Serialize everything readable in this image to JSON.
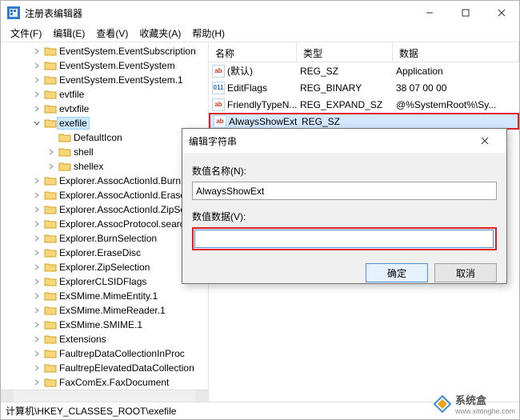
{
  "window": {
    "title": "注册表编辑器"
  },
  "menu": {
    "file": "文件(F)",
    "edit": "编辑(E)",
    "view": "查看(V)",
    "fav": "收藏夹(A)",
    "help": "帮助(H)"
  },
  "tree": [
    {
      "ind": 2,
      "exp": ">",
      "label": "EventSystem.EventSubscription"
    },
    {
      "ind": 2,
      "exp": ">",
      "label": "EventSystem.EventSystem"
    },
    {
      "ind": 2,
      "exp": ">",
      "label": "EventSystem.EventSystem.1"
    },
    {
      "ind": 2,
      "exp": ">",
      "label": "evtfile"
    },
    {
      "ind": 2,
      "exp": ">",
      "label": "evtxfile"
    },
    {
      "ind": 2,
      "exp": "v",
      "label": "exefile",
      "sel": true
    },
    {
      "ind": 3,
      "exp": "",
      "label": "DefaultIcon"
    },
    {
      "ind": 3,
      "exp": ">",
      "label": "shell"
    },
    {
      "ind": 3,
      "exp": ">",
      "label": "shellex"
    },
    {
      "ind": 2,
      "exp": ">",
      "label": "Explorer.AssocActionId.BurnSelection"
    },
    {
      "ind": 2,
      "exp": ">",
      "label": "Explorer.AssocActionId.EraseDisc"
    },
    {
      "ind": 2,
      "exp": ">",
      "label": "Explorer.AssocActionId.ZipSelection"
    },
    {
      "ind": 2,
      "exp": ">",
      "label": "Explorer.AssocProtocol.search-ms"
    },
    {
      "ind": 2,
      "exp": ">",
      "label": "Explorer.BurnSelection"
    },
    {
      "ind": 2,
      "exp": ">",
      "label": "Explorer.EraseDisc"
    },
    {
      "ind": 2,
      "exp": ">",
      "label": "Explorer.ZipSelection"
    },
    {
      "ind": 2,
      "exp": ">",
      "label": "ExplorerCLSIDFlags"
    },
    {
      "ind": 2,
      "exp": ">",
      "label": "ExSMime.MimeEntity.1"
    },
    {
      "ind": 2,
      "exp": ">",
      "label": "ExSMime.MimeReader.1"
    },
    {
      "ind": 2,
      "exp": ">",
      "label": "ExSMime.SMIME.1"
    },
    {
      "ind": 2,
      "exp": ">",
      "label": "Extensions"
    },
    {
      "ind": 2,
      "exp": ">",
      "label": "FaultrepDataCollectionInProc"
    },
    {
      "ind": 2,
      "exp": ">",
      "label": "FaultrepElevatedDataCollection"
    },
    {
      "ind": 2,
      "exp": ">",
      "label": "FaxComEx.FaxDocument"
    }
  ],
  "cols": {
    "name": "名称",
    "type": "类型",
    "data": "数据"
  },
  "rows": [
    {
      "icon": "str",
      "name": "(默认)",
      "type": "REG_SZ",
      "data": "Application"
    },
    {
      "icon": "bin",
      "name": "EditFlags",
      "type": "REG_BINARY",
      "data": "38 07 00 00"
    },
    {
      "icon": "str",
      "name": "FriendlyTypeN...",
      "type": "REG_EXPAND_SZ",
      "data": "@%SystemRoot%\\Sy..."
    },
    {
      "icon": "str",
      "name": "AlwaysShowExt",
      "type": "REG_SZ",
      "data": "",
      "hl": true,
      "sel": true
    }
  ],
  "dlg": {
    "title": "编辑字符串",
    "name_label": "数值名称(N):",
    "name_value": "AlwaysShowExt",
    "data_label": "数值数据(V):",
    "data_value": "",
    "ok": "确定",
    "cancel": "取消"
  },
  "status": "计算机\\HKEY_CLASSES_ROOT\\exefile",
  "watermark": {
    "brand": "系统盒",
    "url": "www.xitonghe.com"
  }
}
